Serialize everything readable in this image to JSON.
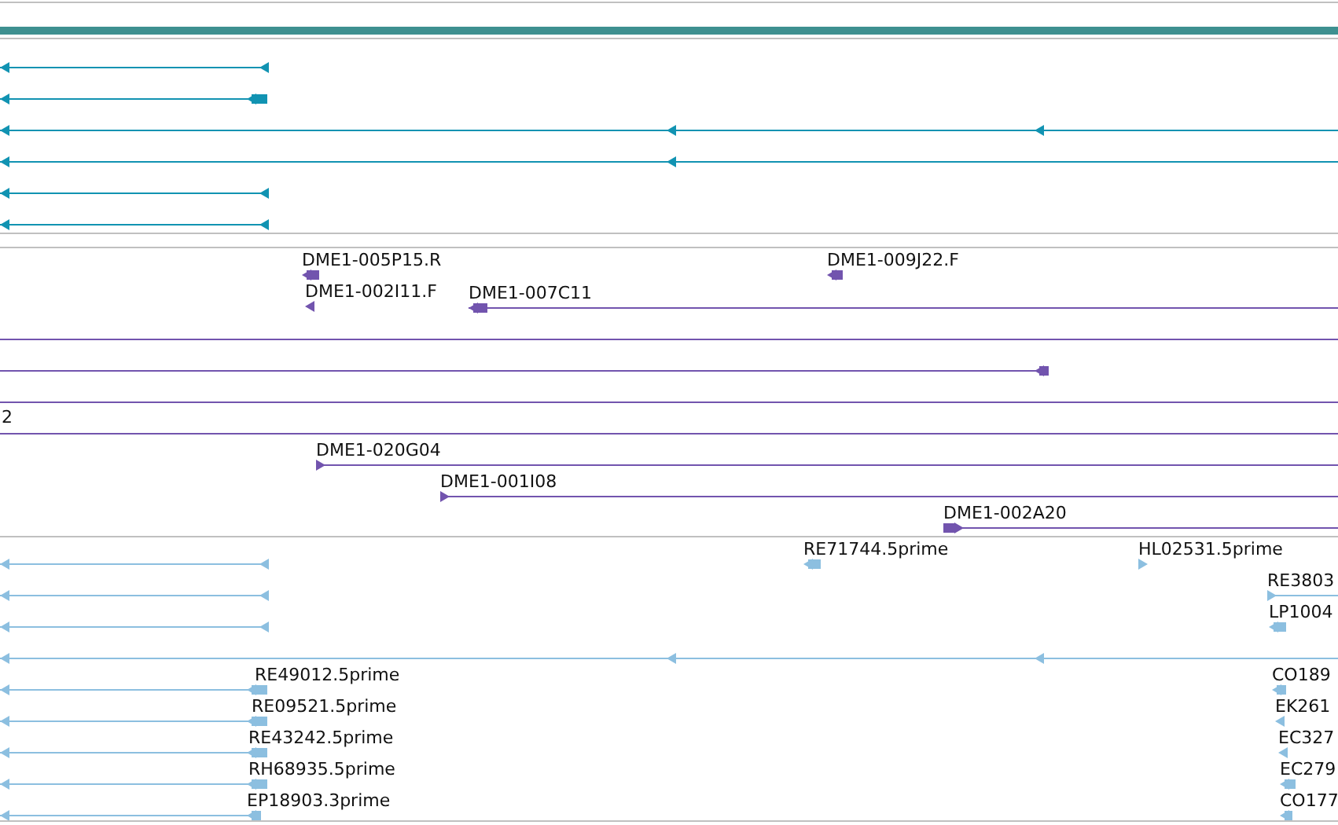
{
  "tracks": [
    {
      "kind": "bar",
      "color": "#3e9090"
    },
    {
      "kind": "features",
      "color": "#1193b2",
      "features": [
        {
          "kind": "arrow",
          "reverse": true
        },
        {
          "kind": "arrow",
          "reverse": true
        },
        {
          "kind": "arrow",
          "reverse": true
        },
        {
          "kind": "arrow",
          "reverse": true
        },
        {
          "kind": "arrow",
          "reverse": true
        },
        {
          "kind": "arrow",
          "reverse": true
        }
      ]
    },
    {
      "kind": "features",
      "color": "#7254ae",
      "features": [
        {
          "kind": "arrow",
          "label": "DME1-005P15.R",
          "reverse": true
        },
        {
          "kind": "arrow",
          "label": "DME1-009J22.F",
          "reverse": true
        },
        {
          "kind": "arrow",
          "label": "DME1-002I11.F",
          "reverse": true
        },
        {
          "kind": "arrow",
          "label": "DME1-007C11",
          "reverse": true
        },
        {
          "kind": "line"
        },
        {
          "kind": "arrow",
          "reverse": true
        },
        {
          "kind": "line"
        },
        {
          "kind": "line",
          "label": "2"
        },
        {
          "kind": "arrow",
          "label": "DME1-020G04",
          "reverse": false
        },
        {
          "kind": "arrow",
          "label": "DME1-001I08",
          "reverse": false
        },
        {
          "kind": "arrow",
          "label": "DME1-002A20",
          "reverse": false
        }
      ]
    },
    {
      "kind": "features",
      "color": "#8cbfe0",
      "features": [
        {
          "kind": "arrow",
          "label": "RE71744.5prime",
          "reverse": true
        },
        {
          "kind": "arrow",
          "label": "HL02531.5prime",
          "reverse": false
        },
        {
          "kind": "arrow",
          "reverse": true
        },
        {
          "kind": "arrow",
          "label": "RE3803",
          "reverse": false
        },
        {
          "kind": "arrow",
          "reverse": true
        },
        {
          "kind": "arrow",
          "label": "LP1004",
          "reverse": true
        },
        {
          "kind": "arrow",
          "reverse": true
        },
        {
          "kind": "arrow",
          "reverse": true
        },
        {
          "kind": "arrow",
          "label": "RE49012.5prime",
          "reverse": true
        },
        {
          "kind": "arrow",
          "label": "CO189",
          "reverse": true
        },
        {
          "kind": "arrow",
          "label": "RE09521.5prime",
          "reverse": true
        },
        {
          "kind": "arrow",
          "label": "EK261",
          "reverse": true
        },
        {
          "kind": "arrow",
          "label": "RE43242.5prime",
          "reverse": true
        },
        {
          "kind": "arrow",
          "label": "EC327",
          "reverse": true
        },
        {
          "kind": "arrow",
          "label": "RH68935.5prime",
          "reverse": true
        },
        {
          "kind": "arrow",
          "label": "EC279",
          "reverse": true
        },
        {
          "kind": "arrow",
          "label": "EP18903.3prime",
          "reverse": true
        },
        {
          "kind": "arrow",
          "label": "CO177",
          "reverse": true
        }
      ]
    }
  ]
}
